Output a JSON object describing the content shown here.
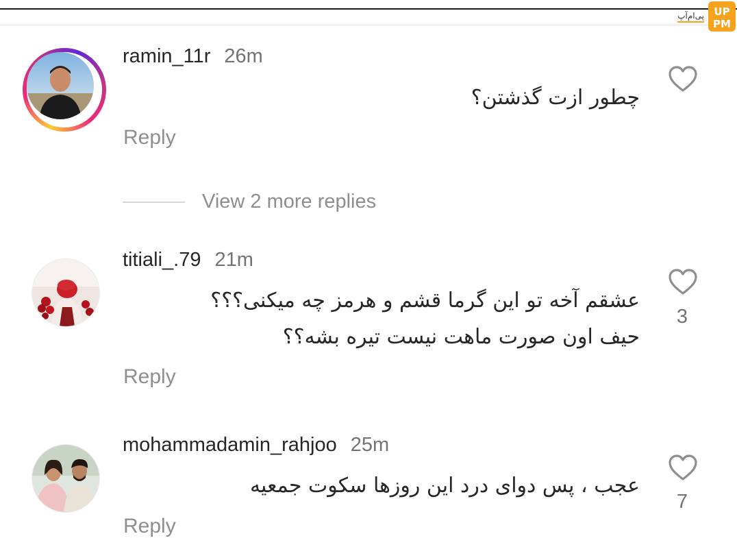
{
  "watermark": {
    "text": "پی‌ام‌آپ",
    "logo_text": "UP PM",
    "accent_color": "#f6a21d"
  },
  "colors": {
    "story_ring": [
      "#f9ce34",
      "#ee2a7b",
      "#6228d7"
    ],
    "secondary_text": "#737373",
    "reply_text": "#8e8e8e"
  },
  "comments": [
    {
      "username": "ramin_11r",
      "time": "26m",
      "text_lines": [
        "چطور ازت گذشتن؟"
      ],
      "reply_label": "Reply",
      "likes": "",
      "has_story": true
    },
    {
      "username": "titiali_.79",
      "time": "21m",
      "text_lines": [
        "عشقم آخه تو این گرما قشم و هرمز چه میکنی؟؟؟",
        "حیف اون صورت ماهت نیست تیره بشه؟؟"
      ],
      "reply_label": "Reply",
      "likes": "3",
      "has_story": false
    },
    {
      "username": "mohammadamin_rahjoo",
      "time": "25m",
      "text_lines": [
        "عجب ، پس دوای درد این روزها سکوت جمعیه"
      ],
      "reply_label": "Reply",
      "likes": "7",
      "has_story": false
    }
  ],
  "view_replies": {
    "label": "View 2 more replies"
  }
}
